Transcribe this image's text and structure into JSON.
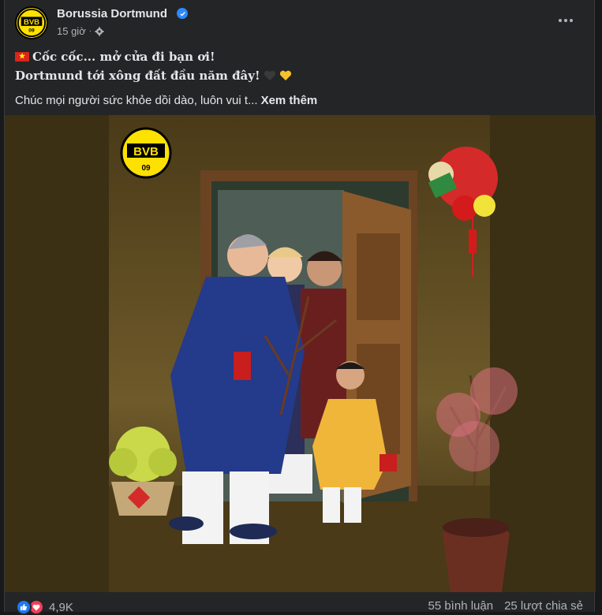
{
  "post": {
    "page_name": "Borussia Dortmund",
    "time": "15 giờ",
    "audience_icon": "gear-icon",
    "line1": "Cốc cốc... mở cửa đi bạn ơi!",
    "line2": "Dortmund tới xông đất đầu năm đây!",
    "line3": "Chúc mọi người sức khỏe dồi dào, luôn vui t...",
    "see_more": "Xem thêm",
    "line1_emoji": "vietnam-flag-icon",
    "line2_emoji": "black-heart-icon, yellow-heart-icon"
  },
  "image": {
    "logo_text": "BVB",
    "logo_number": "09",
    "description_icon": "lunar-new-year-illustration"
  },
  "footer": {
    "reaction_count": "4,9K",
    "comments": "55 bình luận",
    "shares": "25 lượt chia sẻ"
  },
  "colors": {
    "background": "#18191a",
    "card": "#242526",
    "text": "#e4e6eb",
    "muted": "#b0b3b8",
    "verified_blue": "#2d88ff",
    "bvb_yellow": "#fde100"
  }
}
